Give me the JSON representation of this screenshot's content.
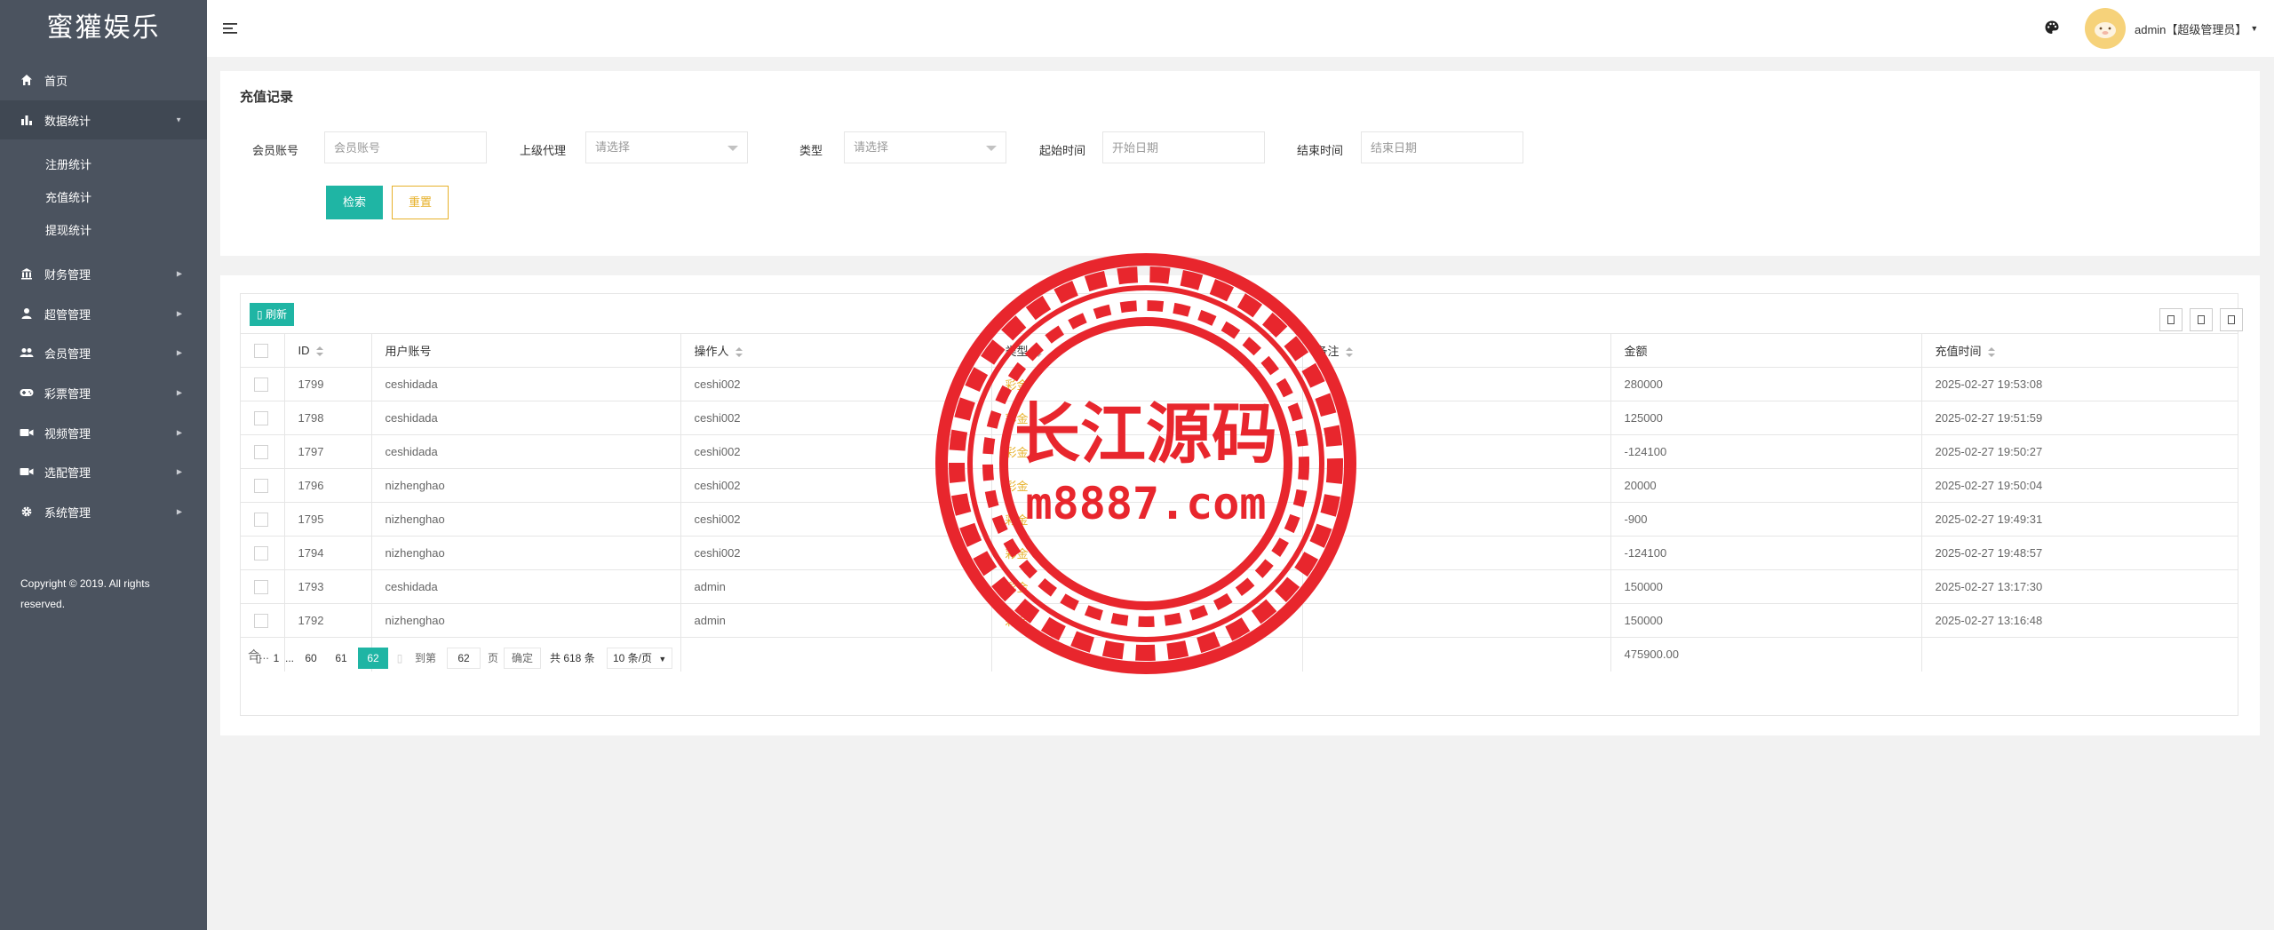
{
  "app": {
    "title": "蜜獾娱乐"
  },
  "sidebar": {
    "items": [
      {
        "label": "首页",
        "icon": "home-icon"
      },
      {
        "label": "数据统计",
        "icon": "bar-chart-icon",
        "expanded": true
      },
      {
        "label": "财务管理",
        "icon": "bank-icon"
      },
      {
        "label": "超管管理",
        "icon": "user-icon"
      },
      {
        "label": "会员管理",
        "icon": "users-icon"
      },
      {
        "label": "彩票管理",
        "icon": "gamepad-icon"
      },
      {
        "label": "视频管理",
        "icon": "video-icon"
      },
      {
        "label": "选配管理",
        "icon": "video-icon"
      },
      {
        "label": "系统管理",
        "icon": "gear-icon"
      }
    ],
    "sub_items": [
      "注册统计",
      "充值统计",
      "提现统计"
    ],
    "copyright": "Copyright © 2019. All rights reserved."
  },
  "header": {
    "user": "admin【超级管理员】",
    "theme_icon": "palette-icon",
    "menu_icon": "menu-fold-icon"
  },
  "search": {
    "title": "充值记录",
    "fields": {
      "member_label": "会员账号",
      "member_placeholder": "会员账号",
      "agent_label": "上级代理",
      "agent_placeholder": "请选择",
      "type_label": "类型",
      "type_placeholder": "请选择",
      "start_label": "起始时间",
      "start_placeholder": "开始日期",
      "end_label": "结束时间",
      "end_placeholder": "结束日期"
    },
    "search_button": "检索",
    "reset_button": "重置"
  },
  "table": {
    "refresh_button": "刷新",
    "columns": [
      "ID",
      "用户账号",
      "操作人",
      "类型",
      "备注",
      "金额",
      "充值时间"
    ],
    "rows": [
      {
        "id": "1799",
        "account": "ceshidada",
        "operator": "ceshi002",
        "type": "彩金",
        "note": "",
        "amount": "280000",
        "time": "2025-02-27 19:53:08"
      },
      {
        "id": "1798",
        "account": "ceshidada",
        "operator": "ceshi002",
        "type": "彩金",
        "note": "",
        "amount": "125000",
        "time": "2025-02-27 19:51:59"
      },
      {
        "id": "1797",
        "account": "ceshidada",
        "operator": "ceshi002",
        "type": "彩金",
        "note": "",
        "amount": "-124100",
        "time": "2025-02-27 19:50:27"
      },
      {
        "id": "1796",
        "account": "nizhenghao",
        "operator": "ceshi002",
        "type": "彩金",
        "note": "",
        "amount": "20000",
        "time": "2025-02-27 19:50:04"
      },
      {
        "id": "1795",
        "account": "nizhenghao",
        "operator": "ceshi002",
        "type": "彩金",
        "note": "",
        "amount": "-900",
        "time": "2025-02-27 19:49:31"
      },
      {
        "id": "1794",
        "account": "nizhenghao",
        "operator": "ceshi002",
        "type": "彩金",
        "note": "",
        "amount": "-124100",
        "time": "2025-02-27 19:48:57"
      },
      {
        "id": "1793",
        "account": "ceshidada",
        "operator": "admin",
        "type": "彩金",
        "note": "",
        "amount": "150000",
        "time": "2025-02-27 13:17:30"
      },
      {
        "id": "1792",
        "account": "nizhenghao",
        "operator": "admin",
        "type": "彩金",
        "note": "",
        "amount": "150000",
        "time": "2025-02-27 13:16:48"
      }
    ],
    "total_label": "合...",
    "total_amount": "475900.00"
  },
  "pagination": {
    "pages": [
      "1",
      "...",
      "60",
      "61",
      "62"
    ],
    "current": "62",
    "goto_label": "到第",
    "goto_value": "62",
    "page_unit": "页",
    "confirm": "确定",
    "total": "共 618 条",
    "per_page": "10 条/页"
  },
  "watermark": {
    "line1": "长江源码",
    "line2": "m8887.com",
    "color": "#e8262d"
  },
  "colors": {
    "sidebar_bg": "#4b535f",
    "accent": "#1fb5a4",
    "warning": "#e7b12a"
  }
}
